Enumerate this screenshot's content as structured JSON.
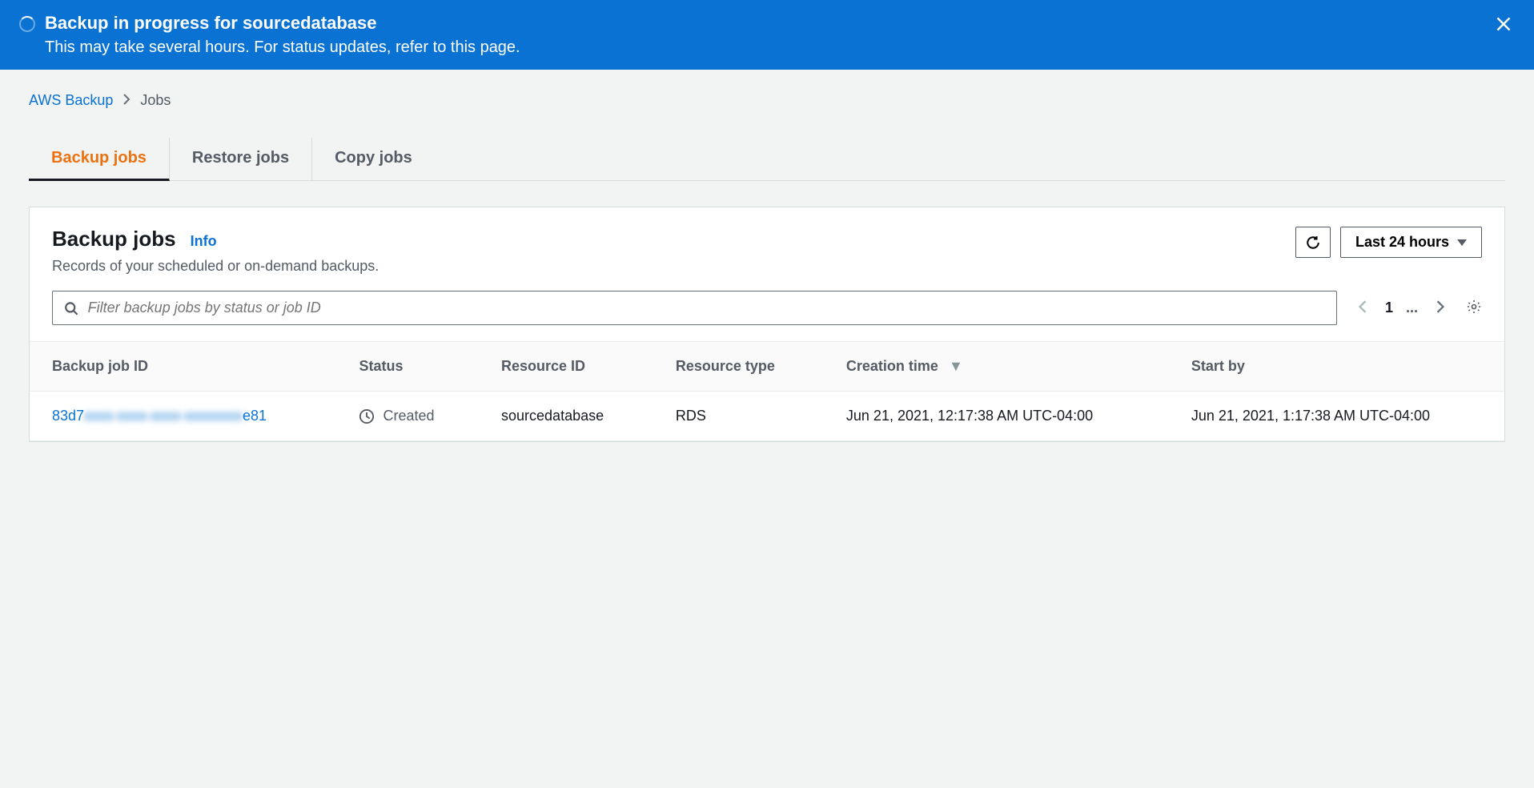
{
  "banner": {
    "title": "Backup in progress for sourcedatabase",
    "subtitle": "This may take several hours. For status updates, refer to this page."
  },
  "breadcrumb": {
    "root": "AWS Backup",
    "current": "Jobs"
  },
  "tabs": {
    "backup": "Backup jobs",
    "restore": "Restore jobs",
    "copy": "Copy jobs"
  },
  "panel": {
    "title": "Backup jobs",
    "info": "Info",
    "subtitle": "Records of your scheduled or on-demand backups.",
    "time_range": "Last 24 hours",
    "filter_placeholder": "Filter backup jobs by status or job ID"
  },
  "pagination": {
    "page": "1",
    "ellipsis": "..."
  },
  "table": {
    "headers": {
      "job_id": "Backup job ID",
      "status": "Status",
      "resource_id": "Resource ID",
      "resource_type": "Resource type",
      "creation_time": "Creation time",
      "start_by": "Start by"
    },
    "rows": [
      {
        "job_id_prefix": "83d7",
        "job_id_hidden": "xxxx-xxxx-xxxx-xxxxxxxx",
        "job_id_suffix": "e81",
        "status": "Created",
        "resource_id": "sourcedatabase",
        "resource_type": "RDS",
        "creation_time": "Jun 21, 2021, 12:17:38 AM UTC-04:00",
        "start_by": "Jun 21, 2021, 1:17:38 AM UTC-04:00"
      }
    ]
  }
}
